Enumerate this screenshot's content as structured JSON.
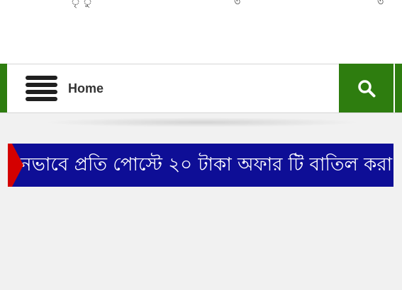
{
  "header": {
    "top_fragments": [
      "ৃ ু",
      "৩",
      "৩"
    ]
  },
  "nav": {
    "menu_icon": "hamburger-menu-icon",
    "home_label": "Home",
    "search_icon": "search-icon",
    "accent_color": "#2e7d0f"
  },
  "ticker": {
    "text": "নভাবে প্রতি পোস্টে ২০ টাকা অফার টি বাতিল করা হচ্ছে",
    "background_color": "#0e0e96",
    "marker_color": "#d40000"
  }
}
